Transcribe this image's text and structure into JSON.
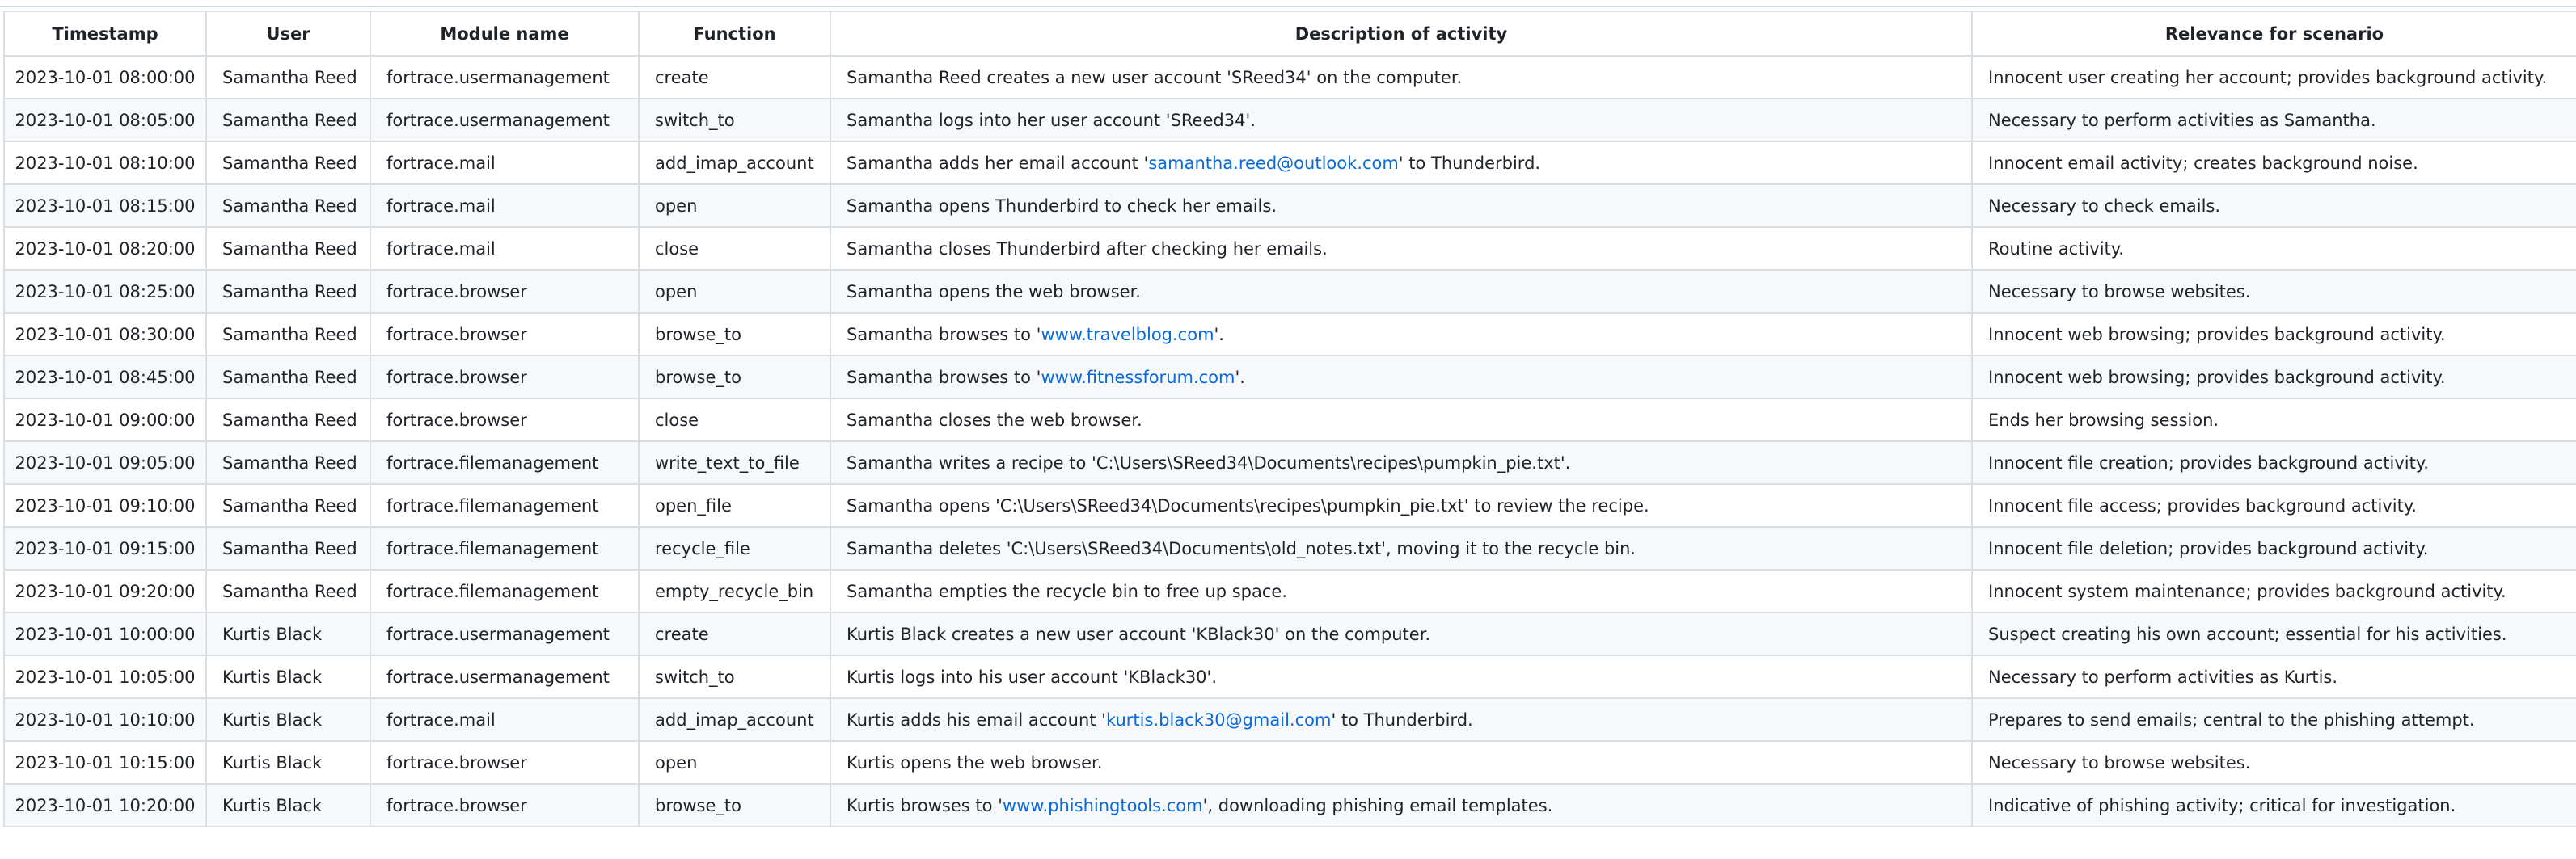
{
  "table": {
    "headers": [
      "Timestamp",
      "User",
      "Module name",
      "Function",
      "Description of activity",
      "Relevance for scenario"
    ],
    "rows": [
      {
        "timestamp": "2023-10-01 08:00:00",
        "user": "Samantha Reed",
        "module": "fortrace.usermanagement",
        "function": "create",
        "desc_before": "Samantha Reed creates a new user account 'SReed34' on the computer.",
        "desc_link": "",
        "desc_after": "",
        "relevance": "Innocent user creating her account; provides background activity."
      },
      {
        "timestamp": "2023-10-01 08:05:00",
        "user": "Samantha Reed",
        "module": "fortrace.usermanagement",
        "function": "switch_to",
        "desc_before": "Samantha logs into her user account 'SReed34'.",
        "desc_link": "",
        "desc_after": "",
        "relevance": "Necessary to perform activities as Samantha."
      },
      {
        "timestamp": "2023-10-01 08:10:00",
        "user": "Samantha Reed",
        "module": "fortrace.mail",
        "function": "add_imap_account",
        "desc_before": "Samantha adds her email account '",
        "desc_link": "samantha.reed@outlook.com",
        "desc_after": "' to Thunderbird.",
        "relevance": "Innocent email activity; creates background noise."
      },
      {
        "timestamp": "2023-10-01 08:15:00",
        "user": "Samantha Reed",
        "module": "fortrace.mail",
        "function": "open",
        "desc_before": "Samantha opens Thunderbird to check her emails.",
        "desc_link": "",
        "desc_after": "",
        "relevance": "Necessary to check emails."
      },
      {
        "timestamp": "2023-10-01 08:20:00",
        "user": "Samantha Reed",
        "module": "fortrace.mail",
        "function": "close",
        "desc_before": "Samantha closes Thunderbird after checking her emails.",
        "desc_link": "",
        "desc_after": "",
        "relevance": "Routine activity."
      },
      {
        "timestamp": "2023-10-01 08:25:00",
        "user": "Samantha Reed",
        "module": "fortrace.browser",
        "function": "open",
        "desc_before": "Samantha opens the web browser.",
        "desc_link": "",
        "desc_after": "",
        "relevance": "Necessary to browse websites."
      },
      {
        "timestamp": "2023-10-01 08:30:00",
        "user": "Samantha Reed",
        "module": "fortrace.browser",
        "function": "browse_to",
        "desc_before": "Samantha browses to '",
        "desc_link": "www.travelblog.com",
        "desc_after": "'.",
        "relevance": "Innocent web browsing; provides background activity."
      },
      {
        "timestamp": "2023-10-01 08:45:00",
        "user": "Samantha Reed",
        "module": "fortrace.browser",
        "function": "browse_to",
        "desc_before": "Samantha browses to '",
        "desc_link": "www.fitnessforum.com",
        "desc_after": "'.",
        "relevance": "Innocent web browsing; provides background activity."
      },
      {
        "timestamp": "2023-10-01 09:00:00",
        "user": "Samantha Reed",
        "module": "fortrace.browser",
        "function": "close",
        "desc_before": "Samantha closes the web browser.",
        "desc_link": "",
        "desc_after": "",
        "relevance": "Ends her browsing session."
      },
      {
        "timestamp": "2023-10-01 09:05:00",
        "user": "Samantha Reed",
        "module": "fortrace.filemanagement",
        "function": "write_text_to_file",
        "desc_before": "Samantha writes a recipe to 'C:\\Users\\SReed34\\Documents\\recipes\\pumpkin_pie.txt'.",
        "desc_link": "",
        "desc_after": "",
        "relevance": "Innocent file creation; provides background activity."
      },
      {
        "timestamp": "2023-10-01 09:10:00",
        "user": "Samantha Reed",
        "module": "fortrace.filemanagement",
        "function": "open_file",
        "desc_before": "Samantha opens 'C:\\Users\\SReed34\\Documents\\recipes\\pumpkin_pie.txt' to review the recipe.",
        "desc_link": "",
        "desc_after": "",
        "relevance": "Innocent file access; provides background activity."
      },
      {
        "timestamp": "2023-10-01 09:15:00",
        "user": "Samantha Reed",
        "module": "fortrace.filemanagement",
        "function": "recycle_file",
        "desc_before": "Samantha deletes 'C:\\Users\\SReed34\\Documents\\old_notes.txt', moving it to the recycle bin.",
        "desc_link": "",
        "desc_after": "",
        "relevance": "Innocent file deletion; provides background activity."
      },
      {
        "timestamp": "2023-10-01 09:20:00",
        "user": "Samantha Reed",
        "module": "fortrace.filemanagement",
        "function": "empty_recycle_bin",
        "desc_before": "Samantha empties the recycle bin to free up space.",
        "desc_link": "",
        "desc_after": "",
        "relevance": "Innocent system maintenance; provides background activity."
      },
      {
        "timestamp": "2023-10-01 10:00:00",
        "user": "Kurtis Black",
        "module": "fortrace.usermanagement",
        "function": "create",
        "desc_before": "Kurtis Black creates a new user account 'KBlack30' on the computer.",
        "desc_link": "",
        "desc_after": "",
        "relevance": "Suspect creating his own account; essential for his activities."
      },
      {
        "timestamp": "2023-10-01 10:05:00",
        "user": "Kurtis Black",
        "module": "fortrace.usermanagement",
        "function": "switch_to",
        "desc_before": "Kurtis logs into his user account 'KBlack30'.",
        "desc_link": "",
        "desc_after": "",
        "relevance": "Necessary to perform activities as Kurtis."
      },
      {
        "timestamp": "2023-10-01 10:10:00",
        "user": "Kurtis Black",
        "module": "fortrace.mail",
        "function": "add_imap_account",
        "desc_before": "Kurtis adds his email account '",
        "desc_link": "kurtis.black30@gmail.com",
        "desc_after": "' to Thunderbird.",
        "relevance": "Prepares to send emails; central to the phishing attempt."
      },
      {
        "timestamp": "2023-10-01 10:15:00",
        "user": "Kurtis Black",
        "module": "fortrace.browser",
        "function": "open",
        "desc_before": "Kurtis opens the web browser.",
        "desc_link": "",
        "desc_after": "",
        "relevance": "Necessary to browse websites."
      },
      {
        "timestamp": "2023-10-01 10:20:00",
        "user": "Kurtis Black",
        "module": "fortrace.browser",
        "function": "browse_to",
        "desc_before": "Kurtis browses to '",
        "desc_link": "www.phishingtools.com",
        "desc_after": "', downloading phishing email templates.",
        "relevance": "Indicative of phishing activity; critical for investigation."
      }
    ]
  },
  "colors": {
    "link": "#0969da",
    "border": "#d9dee3",
    "stripe": "#f6f8fa"
  }
}
